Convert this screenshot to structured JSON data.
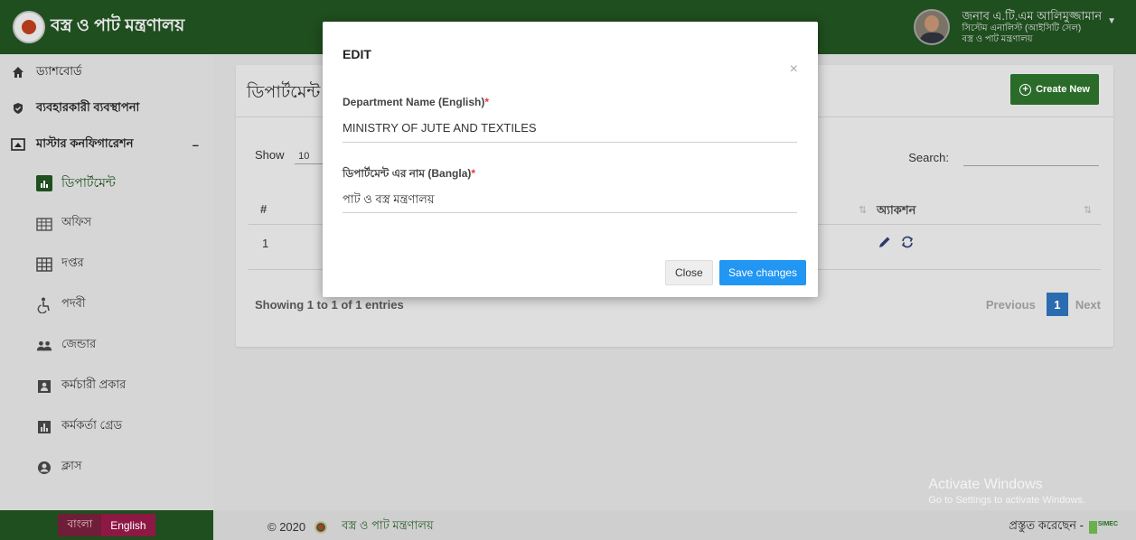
{
  "header": {
    "title": "বস্ত্র ও পাট মন্ত্রণালয়",
    "user_name": "জনাব এ.টি.এম আলিমুজ্জামান",
    "user_role": "সিস্টেম এনালিস্ট (আইসিটি সেল)",
    "user_org": "বস্ত্র ও পাট মন্ত্রণালয়"
  },
  "sidebar": {
    "items": [
      {
        "label": "ড্যাশবোর্ড",
        "icon": "home-icon"
      },
      {
        "label": "ব্যবহারকারী ব্যবস্থাপনা",
        "icon": "shield-icon"
      },
      {
        "label": "মাস্টার কনফিগারেশন",
        "icon": "window-icon",
        "toggle": "–"
      }
    ],
    "subitems": [
      {
        "label": "ডিপার্টমেন্ট",
        "icon": "bar-chart-icon"
      },
      {
        "label": "অফিস",
        "icon": "building-icon"
      },
      {
        "label": "দপ্তর",
        "icon": "grid-icon"
      },
      {
        "label": "পদবী",
        "icon": "wheelchair-icon"
      },
      {
        "label": "জেন্ডার",
        "icon": "people-icon"
      },
      {
        "label": "কর্মচারী প্রকার",
        "icon": "badge-icon"
      },
      {
        "label": "কর্মকর্তা গ্রেড",
        "icon": "bar-chart-icon"
      },
      {
        "label": "ক্লাস",
        "icon": "user-circle-icon"
      }
    ]
  },
  "main": {
    "title": "ডিপার্টমেন্ট",
    "create_label": "Create New",
    "show_label": "Show",
    "page_length": "10",
    "search_label": "Search:",
    "columns": {
      "index": "#",
      "action": "অ্যাকশন"
    },
    "rows": [
      {
        "index": "1"
      }
    ],
    "info": "Showing 1 to 1 of 1 entries",
    "pager": {
      "previous": "Previous",
      "current": "1",
      "next": "Next"
    }
  },
  "modal": {
    "title": "EDIT",
    "close_symbol": "×",
    "field1_label": "Department Name (English)",
    "field1_value": "MINISTRY OF JUTE AND TEXTILES",
    "field2_label": "ডিপার্টমেন্ট এর নাম (Bangla)",
    "field2_value": "পাট ও বস্ত্র মন্ত্রণালয়",
    "required_mark": "*",
    "close_label": "Close",
    "save_label": "Save changes"
  },
  "footer": {
    "lang_bn": "বাংলা",
    "lang_en": "English",
    "copyright": "© 2020",
    "org": "বস্ত্র ও পাট মন্ত্রণালয়",
    "made_by": "প্রস্তুত করেছেন -",
    "vendor": "SIMEC"
  },
  "watermark": {
    "line1": "Activate Windows",
    "line2": "Go to Settings to activate Windows."
  },
  "colors": {
    "brand_green": "#1f4e1f",
    "primary_blue": "#2196f3",
    "english_button": "#8d1843"
  }
}
